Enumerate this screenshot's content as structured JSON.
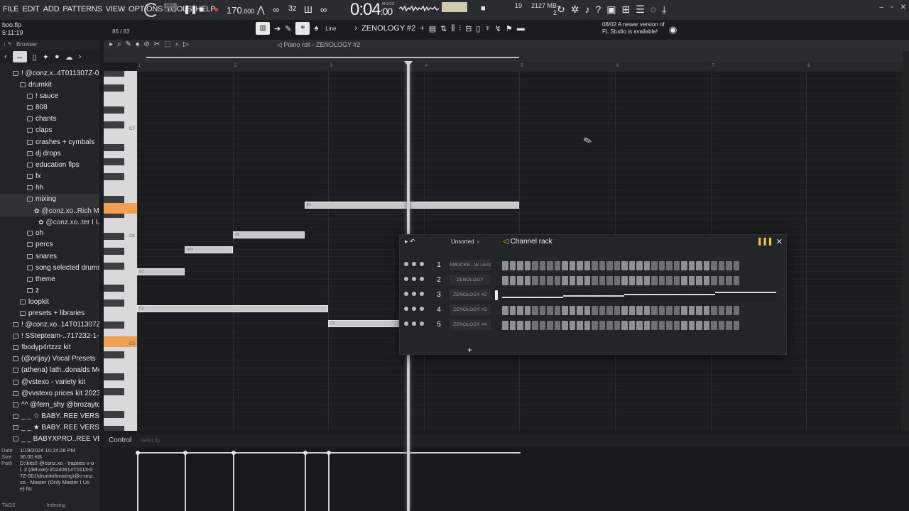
{
  "menu": [
    "FILE",
    "EDIT",
    "ADD",
    "PATTERNS",
    "VIEW",
    "OPTIONS",
    "TOOLS",
    "HELP"
  ],
  "mode": {
    "pat": "PAT",
    "song": "SONG"
  },
  "tempo": {
    "value": "170",
    "decimals": ".000"
  },
  "time": {
    "main": "0:04",
    "sub": ":00",
    "unit": "M:S:CS"
  },
  "mem": {
    "mb": "2127 MB",
    "voices": "2",
    "num": "19"
  },
  "hint": {
    "file": "boo.flp",
    "pos": "5:11:19",
    "counter": "86 / 83"
  },
  "toolbar2": {
    "snap": "Line",
    "channel": "ZENOLOGY #2"
  },
  "news": {
    "date": "08/02",
    "line1": "A newer version of",
    "line2": "FL Studio is available!"
  },
  "browser": {
    "title": "Browser",
    "items": [
      {
        "label": "! @conz.x..4T011307Z-001",
        "indent": 18,
        "type": "folder"
      },
      {
        "label": "drumkit",
        "indent": 28,
        "type": "folder"
      },
      {
        "label": "! sauce",
        "indent": 38,
        "type": "folder"
      },
      {
        "label": "808",
        "indent": 38,
        "type": "folder"
      },
      {
        "label": "chants",
        "indent": 38,
        "type": "folder"
      },
      {
        "label": "claps",
        "indent": 38,
        "type": "folder"
      },
      {
        "label": "crashes + cymbals",
        "indent": 38,
        "type": "folder"
      },
      {
        "label": "dj drops",
        "indent": 38,
        "type": "folder"
      },
      {
        "label": "education flps",
        "indent": 38,
        "type": "folder"
      },
      {
        "label": "fx",
        "indent": 38,
        "type": "folder"
      },
      {
        "label": "hh",
        "indent": 38,
        "type": "folder"
      },
      {
        "label": "mixing",
        "indent": 38,
        "type": "folder",
        "selected": true
      },
      {
        "label": "@conz.xo..Rich Mix) ★",
        "indent": 48,
        "type": "file",
        "selected": true
      },
      {
        "label": "@conz.xo..ter I Use)",
        "indent": 54,
        "type": "file"
      },
      {
        "label": "oh",
        "indent": 38,
        "type": "folder"
      },
      {
        "label": "percs",
        "indent": 38,
        "type": "folder"
      },
      {
        "label": "snares",
        "indent": 38,
        "type": "folder"
      },
      {
        "label": "song selected drums",
        "indent": 38,
        "type": "folder"
      },
      {
        "label": "theme",
        "indent": 38,
        "type": "folder"
      },
      {
        "label": "z",
        "indent": 38,
        "type": "folder"
      },
      {
        "label": "loopkit",
        "indent": 28,
        "type": "folder"
      },
      {
        "label": "presets + libraries",
        "indent": 28,
        "type": "folder"
      },
      {
        "label": "! @conz.xo..14T011307Z-002",
        "indent": 18,
        "type": "folder"
      },
      {
        "label": "! SStepteam-..717232-1-001",
        "indent": 18,
        "type": "folder"
      },
      {
        "label": "!bodyp4rtzzz kit",
        "indent": 18,
        "type": "folder"
      },
      {
        "label": "(@orljay) Vocal Presets",
        "indent": 18,
        "type": "folder"
      },
      {
        "label": "(athena) lath..donalds Meal",
        "indent": 18,
        "type": "folder"
      },
      {
        "label": "@vstexo - variety kit",
        "indent": 18,
        "type": "folder"
      },
      {
        "label": "@vvstexo prices kit 2023",
        "indent": 18,
        "type": "folder"
      },
      {
        "label": "^^ @fern_shy @brozaytolit",
        "indent": 18,
        "type": "folder"
      },
      {
        "label": "_ _ ☆ BABY..REE VERSION]",
        "indent": 18,
        "type": "folder"
      },
      {
        "label": "_ _ ★ BABY..REE VERSION]",
        "indent": 18,
        "type": "folder"
      },
      {
        "label": "_ _ BABYXPRO..REE VERSION]",
        "indent": 18,
        "type": "folder"
      }
    ],
    "footer": {
      "date_label": "Date",
      "date": "1/19/2024 10:24:26 PM",
      "size_label": "Size",
      "size": "36.00 KB",
      "path_label": "Path",
      "path": "D:\\kits\\! @conz.xo - trapties v-ol. 2 (deluxe)-20240614T0113-07Z-001\\drumkit\\mixing\\@c-onz.xo - Master (Only Master I Use).fst"
    },
    "tags": "TAGS",
    "indexing": "Indexing"
  },
  "piano_roll": {
    "title": "Piano roll - ZENOLOGY #2",
    "bars": [
      "1",
      "2",
      "3",
      "4",
      "5",
      "6",
      "7",
      "8"
    ],
    "key_labels": [
      "C7",
      "C6",
      "C5"
    ],
    "notes": [
      {
        "label": "E6",
        "start": 2.75,
        "len": 2.25,
        "row": 18
      },
      {
        "label": "C6",
        "start": 2.0,
        "len": 0.75,
        "row": 22
      },
      {
        "label": "A#5",
        "start": 1.5,
        "len": 0.5,
        "row": 24
      },
      {
        "label": "G5",
        "start": 1.0,
        "len": 0.5,
        "row": 27
      },
      {
        "label": "D5",
        "start": 1.0,
        "len": 2.0,
        "row": 32
      },
      {
        "label": "C5",
        "start": 3.0,
        "len": 0.75,
        "row": 34
      }
    ],
    "control_label": "Control",
    "control_sub": "Velocity",
    "velocities": [
      1.0,
      1.5,
      2.0,
      2.75,
      3.0
    ]
  },
  "channel_rack": {
    "title": "Channel rack",
    "filter": "Unsorted",
    "channels": [
      {
        "num": "1",
        "name": "SMUCKE...W LEAD",
        "mode": "steps"
      },
      {
        "num": "2",
        "name": "ZENOLOGY",
        "mode": "steps"
      },
      {
        "num": "3",
        "name": "ZENOLOGY #2",
        "mode": "piano",
        "selected": true
      },
      {
        "num": "4",
        "name": "ZENOLOGY #3",
        "mode": "steps"
      },
      {
        "num": "5",
        "name": "ZENOLOGY #4",
        "mode": "steps"
      }
    ],
    "add": "+"
  }
}
